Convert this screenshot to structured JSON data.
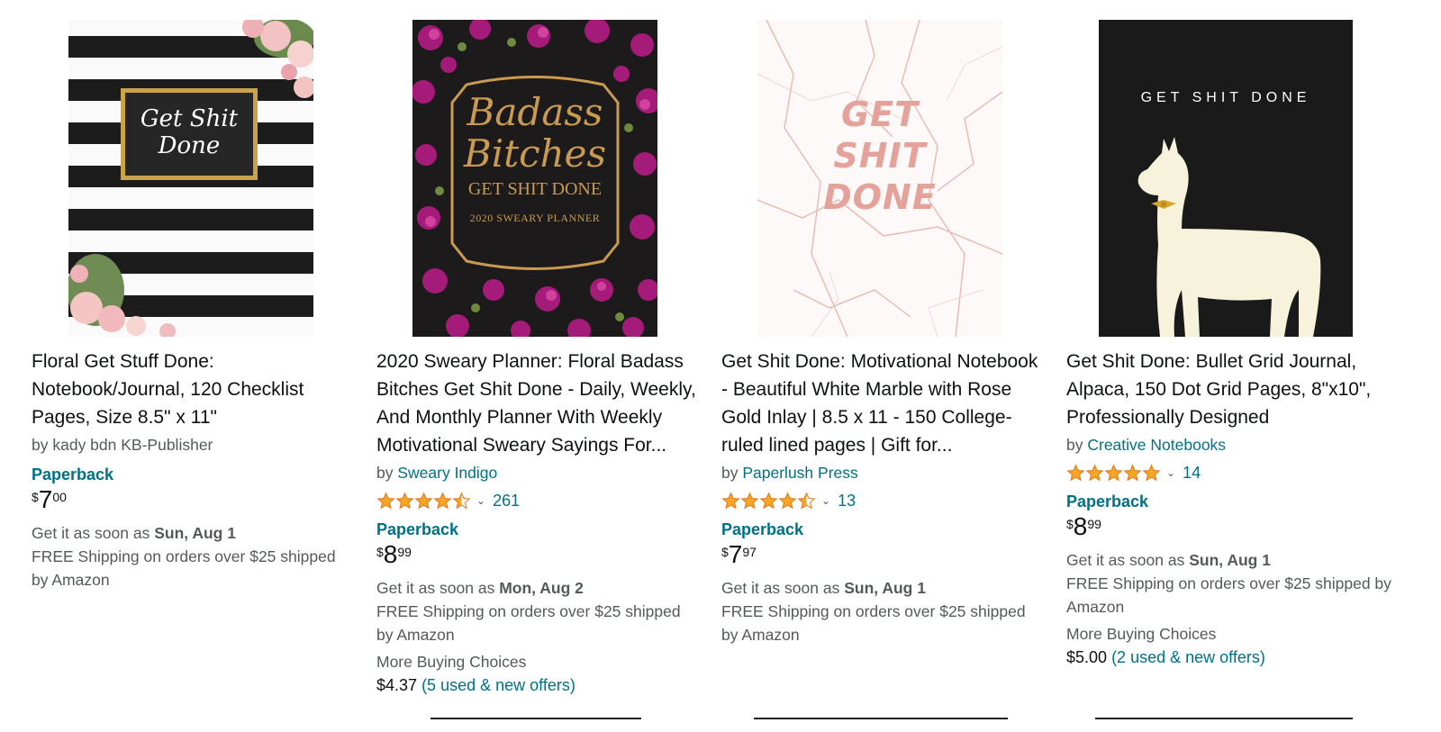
{
  "products": [
    {
      "cover_text": "Get Shit Done",
      "title": "Floral Get Stuff Done: Notebook/Journal, 120 Checklist Pages, Size 8.5\" x 11\"",
      "by_prefix": "by",
      "author": "kady bdn KB-Publisher",
      "author_is_link": false,
      "rating": null,
      "format": "Paperback",
      "price": {
        "symbol": "$",
        "whole": "7",
        "fraction": "00"
      },
      "delivery_prefix": "Get it as soon as",
      "delivery_date": "Sun, Aug 1",
      "shipping": "FREE Shipping on orders over $25 shipped by Amazon",
      "more_label": null,
      "more_price": null,
      "more_offers": null
    },
    {
      "cover_text_1": "Badass",
      "cover_text_2": "Bitches",
      "cover_text_3": "GET SHIT DONE",
      "cover_text_4": "2020 SWEARY PLANNER",
      "title": "2020 Sweary Planner: Floral Badass Bitches Get Shit Done - Daily, Weekly, And Monthly Planner With Weekly Motivational Sweary Sayings For...",
      "by_prefix": "by",
      "author": "Sweary Indigo",
      "author_is_link": true,
      "rating": {
        "stars": 4.5,
        "count": "261"
      },
      "format": "Paperback",
      "price": {
        "symbol": "$",
        "whole": "8",
        "fraction": "99"
      },
      "delivery_prefix": "Get it as soon as",
      "delivery_date": "Mon, Aug 2",
      "shipping": "FREE Shipping on orders over $25 shipped by Amazon",
      "more_label": "More Buying Choices",
      "more_price": "$4.37",
      "more_offers": "(5 used & new offers)"
    },
    {
      "cover_text_1": "GET",
      "cover_text_2": "SHIT",
      "cover_text_3": "DONE",
      "title": "Get Shit Done: Motivational Notebook - Beautiful White Marble with Rose Gold Inlay | 8.5 x 11 - 150 College-ruled lined pages | Gift for...",
      "by_prefix": "by",
      "author": "Paperlush Press",
      "author_is_link": true,
      "rating": {
        "stars": 4.5,
        "count": "13"
      },
      "format": "Paperback",
      "price": {
        "symbol": "$",
        "whole": "7",
        "fraction": "97"
      },
      "delivery_prefix": "Get it as soon as",
      "delivery_date": "Sun, Aug 1",
      "shipping": "FREE Shipping on orders over $25 shipped by Amazon",
      "more_label": null,
      "more_price": null,
      "more_offers": null
    },
    {
      "cover_text": "GET SHIT DONE",
      "title": "Get Shit Done: Bullet Grid Journal, Alpaca, 150 Dot Grid Pages, 8\"x10\", Professionally Designed",
      "by_prefix": "by",
      "author": "Creative Notebooks",
      "author_is_link": true,
      "rating": {
        "stars": 5,
        "count": "14"
      },
      "format": "Paperback",
      "price": {
        "symbol": "$",
        "whole": "8",
        "fraction": "99"
      },
      "delivery_prefix": "Get it as soon as",
      "delivery_date": "Sun, Aug 1",
      "shipping": "FREE Shipping on orders over $25 shipped by Amazon",
      "more_label": "More Buying Choices",
      "more_price": "$5.00",
      "more_offers": "(2 used & new offers)"
    }
  ],
  "colors": {
    "link": "#007185",
    "star": "#f5a623",
    "text": "#0f1111",
    "muted": "#565959"
  },
  "icons": {
    "rating": "star-icon",
    "dropdown": "chevron-down-icon"
  }
}
